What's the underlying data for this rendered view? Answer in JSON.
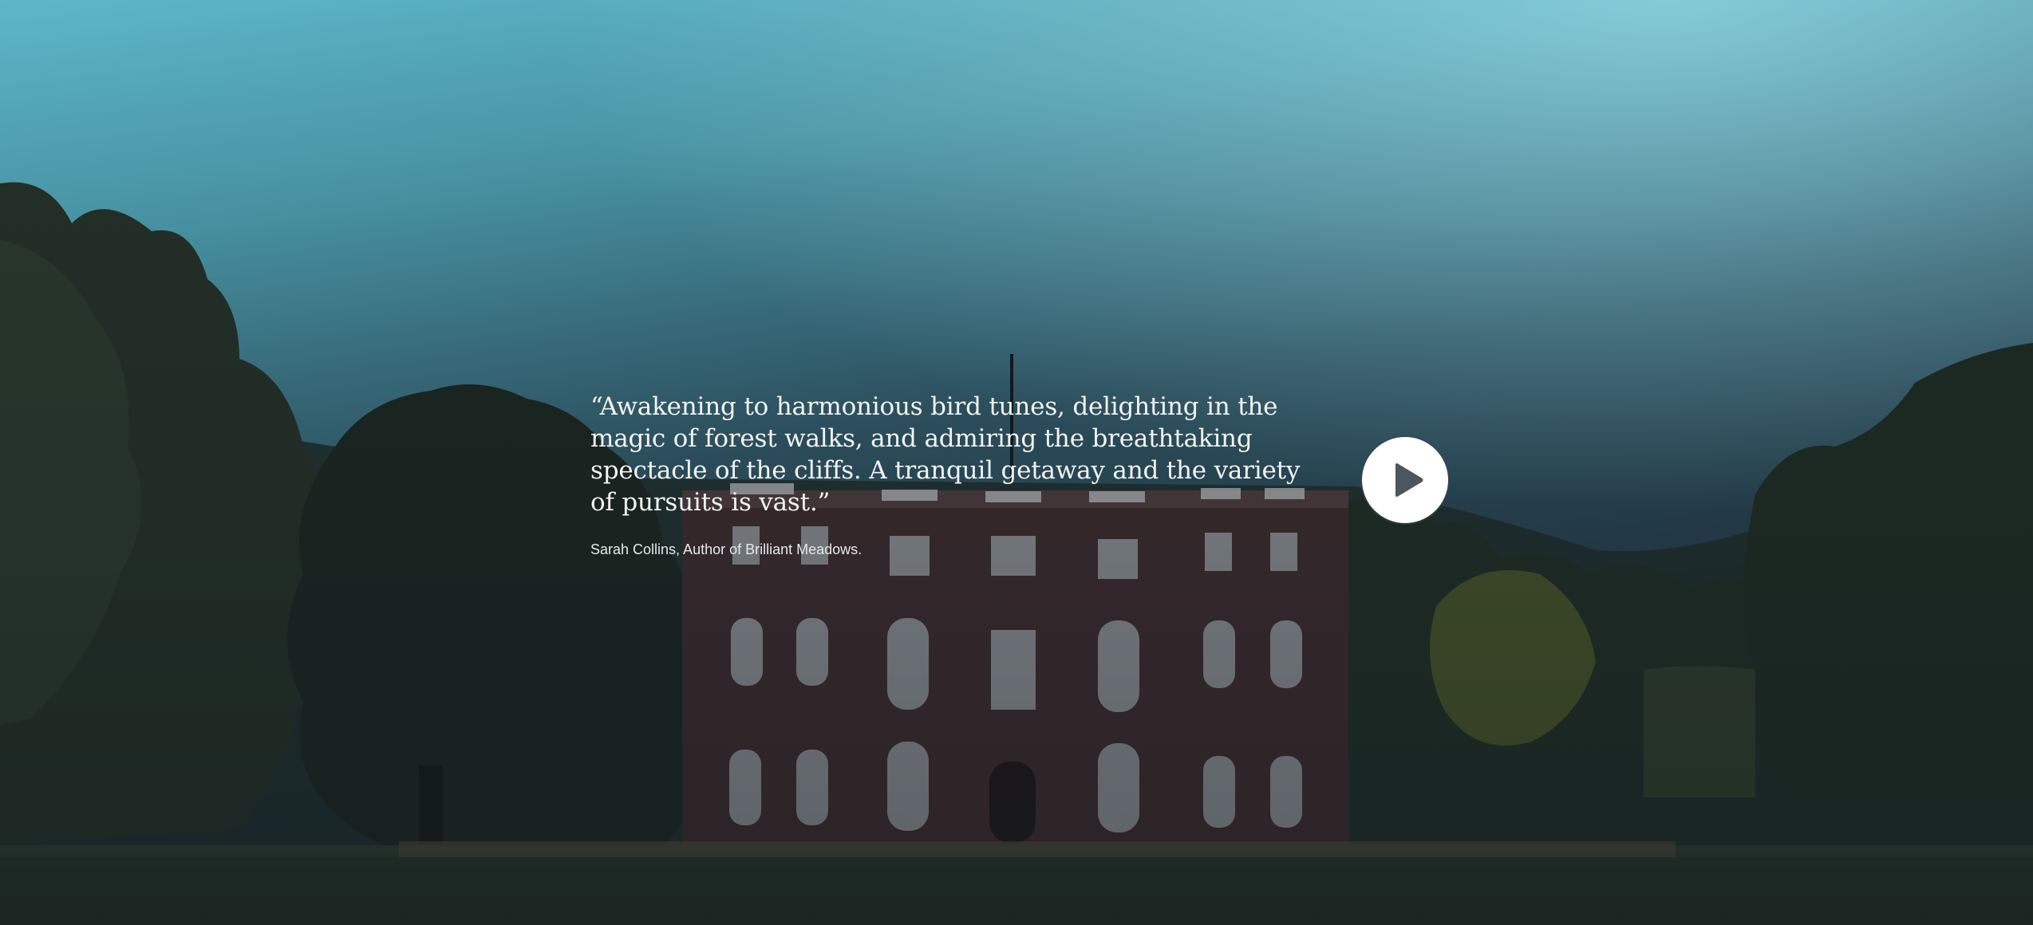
{
  "hero": {
    "quote": "“Awakening to harmonious bird tunes, delighting in the magic of forest walks, and admiring the breathtaking spectacle of the cliffs. A tranquil getaway and the variety of pursuits is vast.”",
    "author": "Sarah Collins, Author of Brilliant Meadows.",
    "play_icon": "play-icon",
    "colors": {
      "sky_top": "#6fc4d2",
      "overlay_dark": "#1f2b35",
      "quote_text": "#f3f4f2",
      "play_button_bg": "#ffffff",
      "play_icon": "#4b5660"
    }
  }
}
